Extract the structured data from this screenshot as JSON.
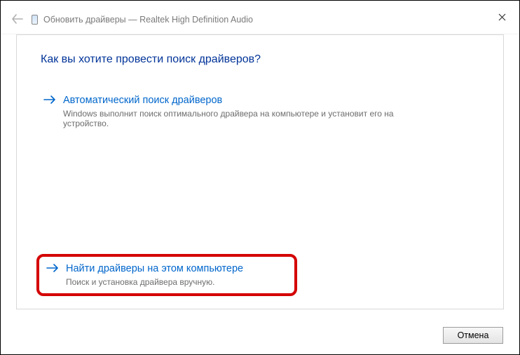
{
  "window": {
    "title": "Обновить драйверы — Realtek High Definition Audio"
  },
  "main": {
    "heading": "Как вы хотите провести поиск драйверов?",
    "options": [
      {
        "title": "Автоматический поиск драйверов",
        "desc": "Windows выполнит поиск оптимального драйвера на компьютере и установит его на устройство."
      },
      {
        "title": "Найти драйверы на этом компьютере",
        "desc": "Поиск и установка драйвера вручную."
      }
    ]
  },
  "footer": {
    "cancel": "Отмена"
  }
}
